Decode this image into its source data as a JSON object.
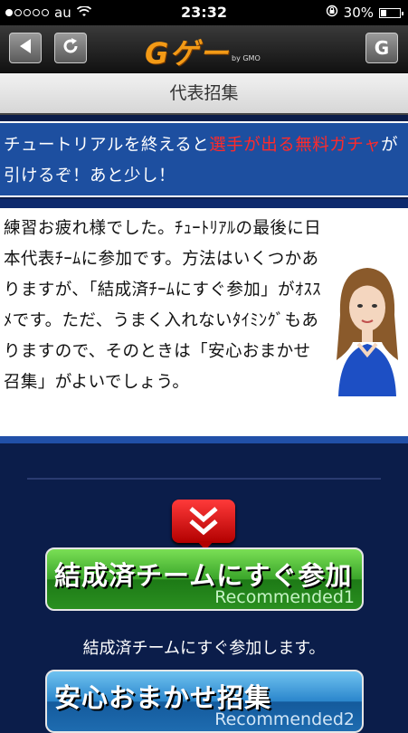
{
  "status_bar": {
    "carrier": "au",
    "time": "23:32",
    "battery": "30%",
    "battery_level": 0.3,
    "signal_bars_filled": 1,
    "signal_bars_total": 5
  },
  "header": {
    "logo_text": "Gゲー",
    "logo_sub": "by GMO",
    "right_button_label": "G"
  },
  "section_title": "代表招集",
  "banner": {
    "part1": "チュートリアルを終えると",
    "part2_red": "選手が出る無料ガチャ",
    "part3": "が引けるぞ！あと少し！"
  },
  "explanation": "練習お疲れ様でした。ﾁｭｰﾄﾘｱﾙの最後に日本代表ﾁｰﾑに参加です。方法はいくつかありますが、「結成済ﾁｰﾑにすぐ参加」がｵｽｽﾒです。ただ、うまく入れないﾀｲﾐﾝｸﾞもありますので、そのときは「安心おまかせ召集」がよいでしょう。",
  "buttons": [
    {
      "label": "結成済チームにすぐ参加",
      "sub": "Recommended1"
    },
    {
      "label": "安心おまかせ招集",
      "sub": "Recommended2"
    }
  ],
  "caption_1": "結成済チームにすぐ参加します。",
  "colors": {
    "accent_red": "#ff2a2a",
    "banner_blue": "#1d4fa0",
    "page_navy": "#0b1d4a",
    "logo_orange": "#f39a16"
  }
}
